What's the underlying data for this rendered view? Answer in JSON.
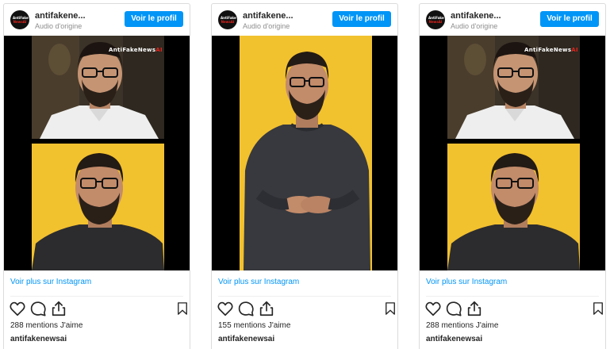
{
  "posts": [
    {
      "username": "antifakene...",
      "audio": "Audio d'origine",
      "profile_button": "Voir le profil",
      "watermark_main": "AntiFakeNews",
      "watermark_accent": "AI",
      "see_more": "Voir plus sur Instagram",
      "likes": "288 mentions J'aime",
      "owner": "antifakenewsai"
    },
    {
      "username": "antifakene...",
      "audio": "Audio d'origine",
      "profile_button": "Voir le profil",
      "see_more": "Voir plus sur Instagram",
      "likes": "155 mentions J'aime",
      "owner": "antifakenewsai"
    },
    {
      "username": "antifakene...",
      "audio": "Audio d'origine",
      "profile_button": "Voir le profil",
      "watermark_main": "AntiFakeNews",
      "watermark_accent": "AI",
      "see_more": "Voir plus sur Instagram",
      "likes": "288 mentions J'aime",
      "owner": "antifakenewsai"
    }
  ],
  "avatar_logo": {
    "line1": "AntiFake",
    "line2": "NewsAI"
  },
  "icons": [
    "heart-icon",
    "comment-icon",
    "share-icon",
    "bookmark-icon"
  ],
  "colors": {
    "accent": "#0095f6",
    "backdrop_yellow": "#f2c12e",
    "watermark_red": "#e0231c"
  }
}
